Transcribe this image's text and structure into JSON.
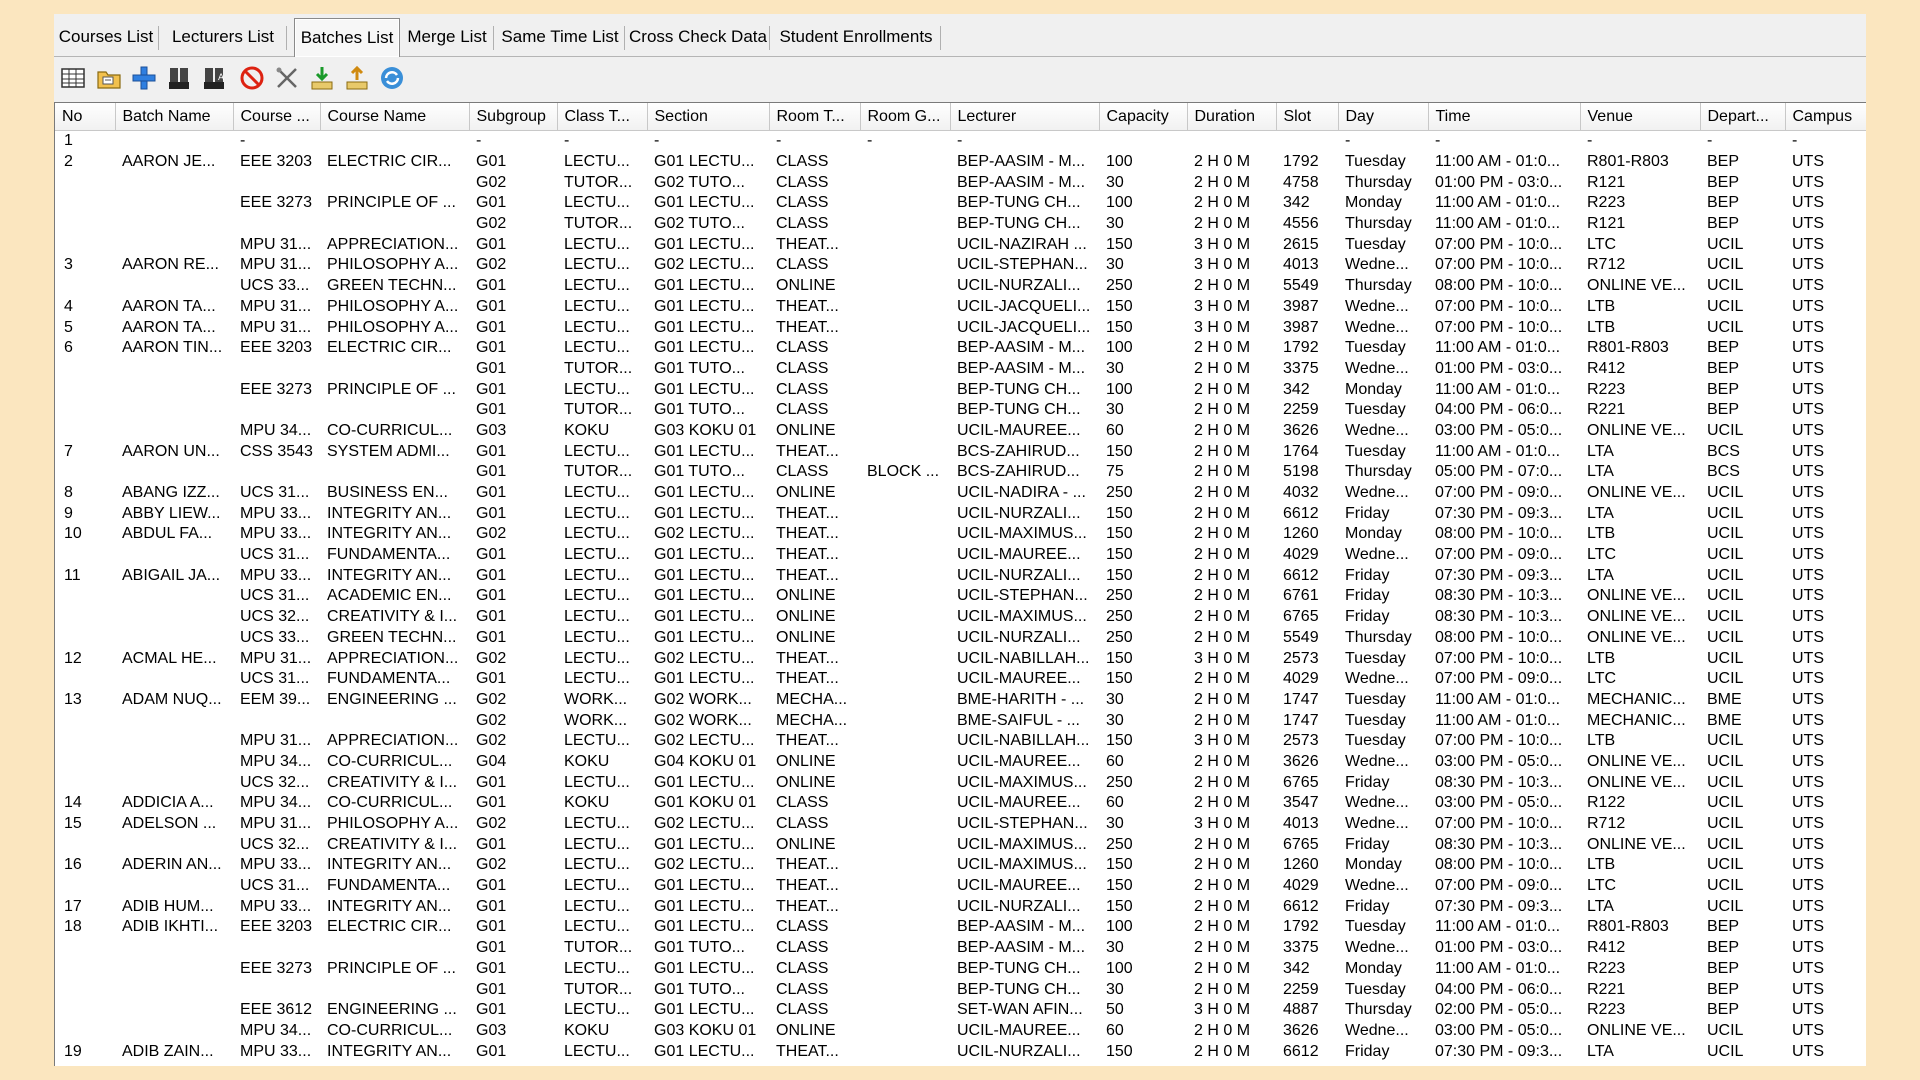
{
  "tabs": [
    {
      "label": "Courses List",
      "active": false
    },
    {
      "label": "Lecturers List",
      "active": false
    },
    {
      "label": "Batches List",
      "active": true
    },
    {
      "label": "Merge List",
      "active": false
    },
    {
      "label": "Same Time List",
      "active": false
    },
    {
      "label": "Cross Check Data",
      "active": false
    },
    {
      "label": "Student Enrollments",
      "active": false
    }
  ],
  "toolbar": [
    {
      "name": "grid-view-icon"
    },
    {
      "name": "open-folder-icon"
    },
    {
      "name": "add-icon"
    },
    {
      "name": "find-icon"
    },
    {
      "name": "find-next-icon"
    },
    {
      "name": "delete-icon"
    },
    {
      "name": "tools-icon"
    },
    {
      "name": "import-icon"
    },
    {
      "name": "export-icon"
    },
    {
      "name": "refresh-icon"
    }
  ],
  "columns": [
    "No",
    "Batch Name",
    "Course ...",
    "Course Name",
    "Subgroup",
    "Class T...",
    "Section",
    "Room T...",
    "Room G...",
    "Lecturer",
    "Capacity",
    "Duration",
    "Slot",
    "Day",
    "Time",
    "Venue",
    "Depart...",
    "Campus"
  ],
  "rows": [
    [
      "1",
      "",
      "-",
      "",
      "-",
      "-",
      "-",
      "-",
      "-",
      "-",
      "",
      "",
      "",
      "-",
      "-",
      "-",
      "-",
      "-"
    ],
    [
      "2",
      "AARON JE...",
      "EEE 3203",
      "ELECTRIC CIR...",
      "G01",
      "LECTU...",
      "G01 LECTU...",
      "CLASS",
      "",
      "BEP-AASIM - M...",
      "100",
      "2 H 0 M",
      "1792",
      "Tuesday",
      "11:00 AM - 01:0...",
      "R801-R803",
      "BEP",
      "UTS"
    ],
    [
      "",
      "",
      "",
      "",
      "G02",
      "TUTOR...",
      "G02 TUTO...",
      "CLASS",
      "",
      "BEP-AASIM - M...",
      "30",
      "2 H 0 M",
      "4758",
      "Thursday",
      "01:00 PM - 03:0...",
      "R121",
      "BEP",
      "UTS"
    ],
    [
      "",
      "",
      "EEE 3273",
      "PRINCIPLE OF ...",
      "G01",
      "LECTU...",
      "G01 LECTU...",
      "CLASS",
      "",
      "BEP-TUNG CH...",
      "100",
      "2 H 0 M",
      "342",
      "Monday",
      "11:00 AM - 01:0...",
      "R223",
      "BEP",
      "UTS"
    ],
    [
      "",
      "",
      "",
      "",
      "G02",
      "TUTOR...",
      "G02 TUTO...",
      "CLASS",
      "",
      "BEP-TUNG CH...",
      "30",
      "2 H 0 M",
      "4556",
      "Thursday",
      "11:00 AM - 01:0...",
      "R121",
      "BEP",
      "UTS"
    ],
    [
      "",
      "",
      "MPU 31...",
      "APPRECIATION...",
      "G01",
      "LECTU...",
      "G01 LECTU...",
      "THEAT...",
      "",
      "UCIL-NAZIRAH ...",
      "150",
      "3 H 0 M",
      "2615",
      "Tuesday",
      "07:00 PM - 10:0...",
      "LTC",
      "UCIL",
      "UTS"
    ],
    [
      "3",
      "AARON RE...",
      "MPU 31...",
      "PHILOSOPHY A...",
      "G02",
      "LECTU...",
      "G02 LECTU...",
      "CLASS",
      "",
      "UCIL-STEPHAN...",
      "30",
      "3 H 0 M",
      "4013",
      "Wedne...",
      "07:00 PM - 10:0...",
      "R712",
      "UCIL",
      "UTS"
    ],
    [
      "",
      "",
      "UCS 33...",
      "GREEN TECHN...",
      "G01",
      "LECTU...",
      "G01 LECTU...",
      "ONLINE",
      "",
      "UCIL-NURZALI...",
      "250",
      "2 H 0 M",
      "5549",
      "Thursday",
      "08:00 PM - 10:0...",
      "ONLINE VE...",
      "UCIL",
      "UTS"
    ],
    [
      "4",
      "AARON TA...",
      "MPU 31...",
      "PHILOSOPHY A...",
      "G01",
      "LECTU...",
      "G01 LECTU...",
      "THEAT...",
      "",
      "UCIL-JACQUELI...",
      "150",
      "3 H 0 M",
      "3987",
      "Wedne...",
      "07:00 PM - 10:0...",
      "LTB",
      "UCIL",
      "UTS"
    ],
    [
      "5",
      "AARON TA...",
      "MPU 31...",
      "PHILOSOPHY A...",
      "G01",
      "LECTU...",
      "G01 LECTU...",
      "THEAT...",
      "",
      "UCIL-JACQUELI...",
      "150",
      "3 H 0 M",
      "3987",
      "Wedne...",
      "07:00 PM - 10:0...",
      "LTB",
      "UCIL",
      "UTS"
    ],
    [
      "6",
      "AARON TIN...",
      "EEE 3203",
      "ELECTRIC CIR...",
      "G01",
      "LECTU...",
      "G01 LECTU...",
      "CLASS",
      "",
      "BEP-AASIM - M...",
      "100",
      "2 H 0 M",
      "1792",
      "Tuesday",
      "11:00 AM - 01:0...",
      "R801-R803",
      "BEP",
      "UTS"
    ],
    [
      "",
      "",
      "",
      "",
      "G01",
      "TUTOR...",
      "G01 TUTO...",
      "CLASS",
      "",
      "BEP-AASIM - M...",
      "30",
      "2 H 0 M",
      "3375",
      "Wedne...",
      "01:00 PM - 03:0...",
      "R412",
      "BEP",
      "UTS"
    ],
    [
      "",
      "",
      "EEE 3273",
      "PRINCIPLE OF ...",
      "G01",
      "LECTU...",
      "G01 LECTU...",
      "CLASS",
      "",
      "BEP-TUNG CH...",
      "100",
      "2 H 0 M",
      "342",
      "Monday",
      "11:00 AM - 01:0...",
      "R223",
      "BEP",
      "UTS"
    ],
    [
      "",
      "",
      "",
      "",
      "G01",
      "TUTOR...",
      "G01 TUTO...",
      "CLASS",
      "",
      "BEP-TUNG CH...",
      "30",
      "2 H 0 M",
      "2259",
      "Tuesday",
      "04:00 PM - 06:0...",
      "R221",
      "BEP",
      "UTS"
    ],
    [
      "",
      "",
      "MPU 34...",
      "CO-CURRICUL...",
      "G03",
      "KOKU",
      "G03 KOKU 01",
      "ONLINE",
      "",
      "UCIL-MAUREE...",
      "60",
      "2 H 0 M",
      "3626",
      "Wedne...",
      "03:00 PM - 05:0...",
      "ONLINE VE...",
      "UCIL",
      "UTS"
    ],
    [
      "7",
      "AARON UN...",
      "CSS 3543",
      "SYSTEM ADMI...",
      "G01",
      "LECTU...",
      "G01 LECTU...",
      "THEAT...",
      "",
      "BCS-ZAHIRUD...",
      "150",
      "2 H 0 M",
      "1764",
      "Tuesday",
      "11:00 AM - 01:0...",
      "LTA",
      "BCS",
      "UTS"
    ],
    [
      "",
      "",
      "",
      "",
      "G01",
      "TUTOR...",
      "G01 TUTO...",
      "CLASS",
      "BLOCK ...",
      "BCS-ZAHIRUD...",
      "75",
      "2 H 0 M",
      "5198",
      "Thursday",
      "05:00 PM - 07:0...",
      "LTA",
      "BCS",
      "UTS"
    ],
    [
      "8",
      "ABANG IZZ...",
      "UCS 31...",
      "BUSINESS EN...",
      "G01",
      "LECTU...",
      "G01 LECTU...",
      "ONLINE",
      "",
      "UCIL-NADIRA - ...",
      "250",
      "2 H 0 M",
      "4032",
      "Wedne...",
      "07:00 PM - 09:0...",
      "ONLINE VE...",
      "UCIL",
      "UTS"
    ],
    [
      "9",
      "ABBY LIEW...",
      "MPU 33...",
      "INTEGRITY AN...",
      "G01",
      "LECTU...",
      "G01 LECTU...",
      "THEAT...",
      "",
      "UCIL-NURZALI...",
      "150",
      "2 H 0 M",
      "6612",
      "Friday",
      "07:30 PM - 09:3...",
      "LTA",
      "UCIL",
      "UTS"
    ],
    [
      "10",
      "ABDUL FA...",
      "MPU 33...",
      "INTEGRITY AN...",
      "G02",
      "LECTU...",
      "G02 LECTU...",
      "THEAT...",
      "",
      "UCIL-MAXIMUS...",
      "150",
      "2 H 0 M",
      "1260",
      "Monday",
      "08:00 PM - 10:0...",
      "LTB",
      "UCIL",
      "UTS"
    ],
    [
      "",
      "",
      "UCS 31...",
      "FUNDAMENTA...",
      "G01",
      "LECTU...",
      "G01 LECTU...",
      "THEAT...",
      "",
      "UCIL-MAUREE...",
      "150",
      "2 H 0 M",
      "4029",
      "Wedne...",
      "07:00 PM - 09:0...",
      "LTC",
      "UCIL",
      "UTS"
    ],
    [
      "11",
      "ABIGAIL JA...",
      "MPU 33...",
      "INTEGRITY AN...",
      "G01",
      "LECTU...",
      "G01 LECTU...",
      "THEAT...",
      "",
      "UCIL-NURZALI...",
      "150",
      "2 H 0 M",
      "6612",
      "Friday",
      "07:30 PM - 09:3...",
      "LTA",
      "UCIL",
      "UTS"
    ],
    [
      "",
      "",
      "UCS 31...",
      "ACADEMIC EN...",
      "G01",
      "LECTU...",
      "G01 LECTU...",
      "ONLINE",
      "",
      "UCIL-STEPHAN...",
      "250",
      "2 H 0 M",
      "6761",
      "Friday",
      "08:30 PM - 10:3...",
      "ONLINE VE...",
      "UCIL",
      "UTS"
    ],
    [
      "",
      "",
      "UCS 32...",
      "CREATIVITY & I...",
      "G01",
      "LECTU...",
      "G01 LECTU...",
      "ONLINE",
      "",
      "UCIL-MAXIMUS...",
      "250",
      "2 H 0 M",
      "6765",
      "Friday",
      "08:30 PM - 10:3...",
      "ONLINE VE...",
      "UCIL",
      "UTS"
    ],
    [
      "",
      "",
      "UCS 33...",
      "GREEN TECHN...",
      "G01",
      "LECTU...",
      "G01 LECTU...",
      "ONLINE",
      "",
      "UCIL-NURZALI...",
      "250",
      "2 H 0 M",
      "5549",
      "Thursday",
      "08:00 PM - 10:0...",
      "ONLINE VE...",
      "UCIL",
      "UTS"
    ],
    [
      "12",
      "ACMAL HE...",
      "MPU 31...",
      "APPRECIATION...",
      "G02",
      "LECTU...",
      "G02 LECTU...",
      "THEAT...",
      "",
      "UCIL-NABILLAH...",
      "150",
      "3 H 0 M",
      "2573",
      "Tuesday",
      "07:00 PM - 10:0...",
      "LTB",
      "UCIL",
      "UTS"
    ],
    [
      "",
      "",
      "UCS 31...",
      "FUNDAMENTA...",
      "G01",
      "LECTU...",
      "G01 LECTU...",
      "THEAT...",
      "",
      "UCIL-MAUREE...",
      "150",
      "2 H 0 M",
      "4029",
      "Wedne...",
      "07:00 PM - 09:0...",
      "LTC",
      "UCIL",
      "UTS"
    ],
    [
      "13",
      "ADAM NUQ...",
      "EEM 39...",
      "ENGINEERING ...",
      "G02",
      "WORK...",
      "G02 WORK...",
      "MECHA...",
      "",
      "BME-HARITH - ...",
      "30",
      "2 H 0 M",
      "1747",
      "Tuesday",
      "11:00 AM - 01:0...",
      "MECHANIC...",
      "BME",
      "UTS"
    ],
    [
      "",
      "",
      "",
      "",
      "G02",
      "WORK...",
      "G02 WORK...",
      "MECHA...",
      "",
      "BME-SAIFUL - ...",
      "30",
      "2 H 0 M",
      "1747",
      "Tuesday",
      "11:00 AM - 01:0...",
      "MECHANIC...",
      "BME",
      "UTS"
    ],
    [
      "",
      "",
      "MPU 31...",
      "APPRECIATION...",
      "G02",
      "LECTU...",
      "G02 LECTU...",
      "THEAT...",
      "",
      "UCIL-NABILLAH...",
      "150",
      "3 H 0 M",
      "2573",
      "Tuesday",
      "07:00 PM - 10:0...",
      "LTB",
      "UCIL",
      "UTS"
    ],
    [
      "",
      "",
      "MPU 34...",
      "CO-CURRICUL...",
      "G04",
      "KOKU",
      "G04 KOKU 01",
      "ONLINE",
      "",
      "UCIL-MAUREE...",
      "60",
      "2 H 0 M",
      "3626",
      "Wedne...",
      "03:00 PM - 05:0...",
      "ONLINE VE...",
      "UCIL",
      "UTS"
    ],
    [
      "",
      "",
      "UCS 32...",
      "CREATIVITY & I...",
      "G01",
      "LECTU...",
      "G01 LECTU...",
      "ONLINE",
      "",
      "UCIL-MAXIMUS...",
      "250",
      "2 H 0 M",
      "6765",
      "Friday",
      "08:30 PM - 10:3...",
      "ONLINE VE...",
      "UCIL",
      "UTS"
    ],
    [
      "14",
      "ADDICIA A...",
      "MPU 34...",
      "CO-CURRICUL...",
      "G01",
      "KOKU",
      "G01 KOKU 01",
      "CLASS",
      "",
      "UCIL-MAUREE...",
      "60",
      "2 H 0 M",
      "3547",
      "Wedne...",
      "03:00 PM - 05:0...",
      "R122",
      "UCIL",
      "UTS"
    ],
    [
      "15",
      "ADELSON ...",
      "MPU 31...",
      "PHILOSOPHY A...",
      "G02",
      "LECTU...",
      "G02 LECTU...",
      "CLASS",
      "",
      "UCIL-STEPHAN...",
      "30",
      "3 H 0 M",
      "4013",
      "Wedne...",
      "07:00 PM - 10:0...",
      "R712",
      "UCIL",
      "UTS"
    ],
    [
      "",
      "",
      "UCS 32...",
      "CREATIVITY & I...",
      "G01",
      "LECTU...",
      "G01 LECTU...",
      "ONLINE",
      "",
      "UCIL-MAXIMUS...",
      "250",
      "2 H 0 M",
      "6765",
      "Friday",
      "08:30 PM - 10:3...",
      "ONLINE VE...",
      "UCIL",
      "UTS"
    ],
    [
      "16",
      "ADERIN AN...",
      "MPU 33...",
      "INTEGRITY AN...",
      "G02",
      "LECTU...",
      "G02 LECTU...",
      "THEAT...",
      "",
      "UCIL-MAXIMUS...",
      "150",
      "2 H 0 M",
      "1260",
      "Monday",
      "08:00 PM - 10:0...",
      "LTB",
      "UCIL",
      "UTS"
    ],
    [
      "",
      "",
      "UCS 31...",
      "FUNDAMENTA...",
      "G01",
      "LECTU...",
      "G01 LECTU...",
      "THEAT...",
      "",
      "UCIL-MAUREE...",
      "150",
      "2 H 0 M",
      "4029",
      "Wedne...",
      "07:00 PM - 09:0...",
      "LTC",
      "UCIL",
      "UTS"
    ],
    [
      "17",
      "ADIB HUM...",
      "MPU 33...",
      "INTEGRITY AN...",
      "G01",
      "LECTU...",
      "G01 LECTU...",
      "THEAT...",
      "",
      "UCIL-NURZALI...",
      "150",
      "2 H 0 M",
      "6612",
      "Friday",
      "07:30 PM - 09:3...",
      "LTA",
      "UCIL",
      "UTS"
    ],
    [
      "18",
      "ADIB IKHTI...",
      "EEE 3203",
      "ELECTRIC CIR...",
      "G01",
      "LECTU...",
      "G01 LECTU...",
      "CLASS",
      "",
      "BEP-AASIM - M...",
      "100",
      "2 H 0 M",
      "1792",
      "Tuesday",
      "11:00 AM - 01:0...",
      "R801-R803",
      "BEP",
      "UTS"
    ],
    [
      "",
      "",
      "",
      "",
      "G01",
      "TUTOR...",
      "G01 TUTO...",
      "CLASS",
      "",
      "BEP-AASIM - M...",
      "30",
      "2 H 0 M",
      "3375",
      "Wedne...",
      "01:00 PM - 03:0...",
      "R412",
      "BEP",
      "UTS"
    ],
    [
      "",
      "",
      "EEE 3273",
      "PRINCIPLE OF ...",
      "G01",
      "LECTU...",
      "G01 LECTU...",
      "CLASS",
      "",
      "BEP-TUNG CH...",
      "100",
      "2 H 0 M",
      "342",
      "Monday",
      "11:00 AM - 01:0...",
      "R223",
      "BEP",
      "UTS"
    ],
    [
      "",
      "",
      "",
      "",
      "G01",
      "TUTOR...",
      "G01 TUTO...",
      "CLASS",
      "",
      "BEP-TUNG CH...",
      "30",
      "2 H 0 M",
      "2259",
      "Tuesday",
      "04:00 PM - 06:0...",
      "R221",
      "BEP",
      "UTS"
    ],
    [
      "",
      "",
      "EEE 3612",
      "ENGINEERING ...",
      "G01",
      "LECTU...",
      "G01 LECTU...",
      "CLASS",
      "",
      "SET-WAN AFIN...",
      "50",
      "3 H 0 M",
      "4887",
      "Thursday",
      "02:00 PM - 05:0...",
      "R223",
      "BEP",
      "UTS"
    ],
    [
      "",
      "",
      "MPU 34...",
      "CO-CURRICUL...",
      "G03",
      "KOKU",
      "G03 KOKU 01",
      "ONLINE",
      "",
      "UCIL-MAUREE...",
      "60",
      "2 H 0 M",
      "3626",
      "Wedne...",
      "03:00 PM - 05:0...",
      "ONLINE VE...",
      "UCIL",
      "UTS"
    ],
    [
      "19",
      "ADIB ZAIN...",
      "MPU 33...",
      "INTEGRITY AN...",
      "G01",
      "LECTU...",
      "G01 LECTU...",
      "THEAT...",
      "",
      "UCIL-NURZALI...",
      "150",
      "2 H 0 M",
      "6612",
      "Friday",
      "07:30 PM - 09:3...",
      "LTA",
      "UCIL",
      "UTS"
    ]
  ]
}
